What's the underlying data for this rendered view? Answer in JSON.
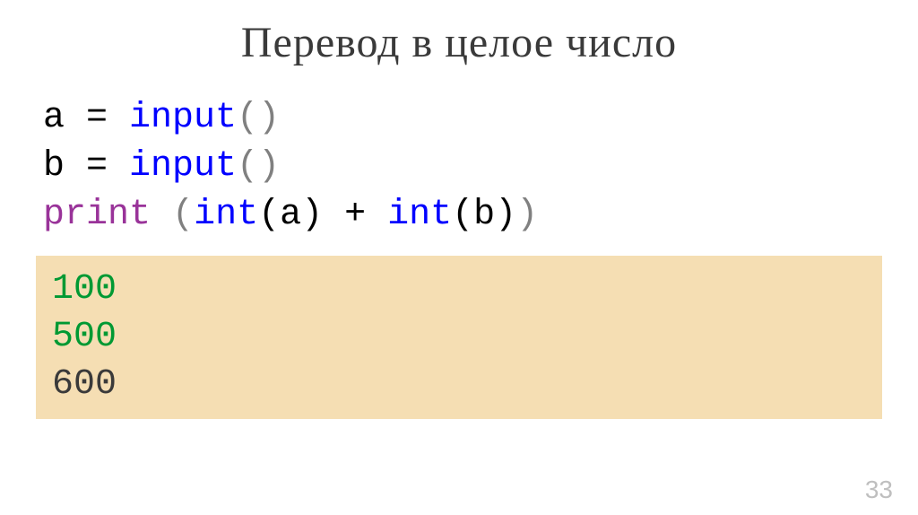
{
  "slide": {
    "title": "Перевод в целое число",
    "page_number": "33"
  },
  "code": {
    "line1": {
      "var": "a = ",
      "fn": "input",
      "parens": "()"
    },
    "line2": {
      "var": "b = ",
      "fn": "input",
      "parens": "()"
    },
    "line3": {
      "print_kw": "print",
      "space": " ",
      "open1": "(",
      "int1": "int",
      "args1": "(a) + ",
      "int2": "int",
      "args2": "(b)",
      "close1": ")"
    }
  },
  "output": {
    "input1": "100",
    "input2": "500",
    "result": "600"
  }
}
